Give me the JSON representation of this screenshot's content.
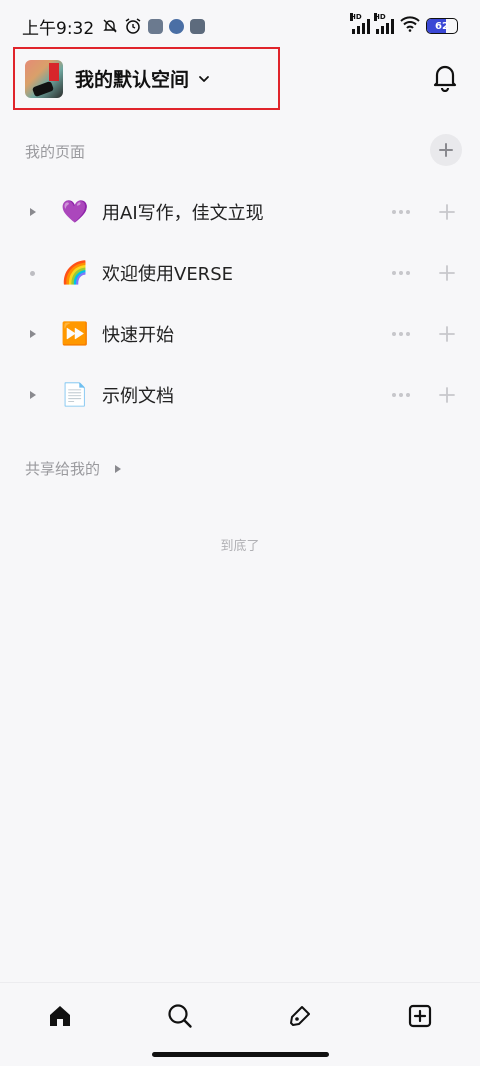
{
  "status_bar": {
    "time": "上午9:32",
    "battery": "62",
    "battery_level_percent": 62,
    "icons": [
      "mute-bell-icon",
      "alarm-icon",
      "app-icon",
      "app-icon",
      "app-icon",
      "signal-hd-icon",
      "signal-hd-icon",
      "wifi-icon",
      "battery-icon"
    ]
  },
  "header": {
    "workspace_name": "我的默认空间",
    "icons": [
      "chevron-down-icon",
      "bell-icon"
    ]
  },
  "my_pages": {
    "title": "我的页面",
    "items": [
      {
        "emoji": "💜",
        "label": "用AI写作，佳文立现",
        "expand": "caret"
      },
      {
        "emoji": "🌈",
        "label": "欢迎使用VERSE",
        "expand": "dot"
      },
      {
        "emoji": "⏩",
        "label": "快速开始",
        "expand": "caret"
      },
      {
        "emoji": "📄",
        "label": "示例文档",
        "expand": "caret"
      }
    ]
  },
  "shared": {
    "title": "共享给我的"
  },
  "end_text": "到底了",
  "bottom_nav": {
    "tabs": [
      "home-icon",
      "search-icon",
      "edit-tag-icon",
      "add-square-icon"
    ]
  },
  "colors": {
    "background": "#f7f7f9",
    "highlight_border": "#e0242b",
    "battery_fill": "#3a47d5"
  }
}
